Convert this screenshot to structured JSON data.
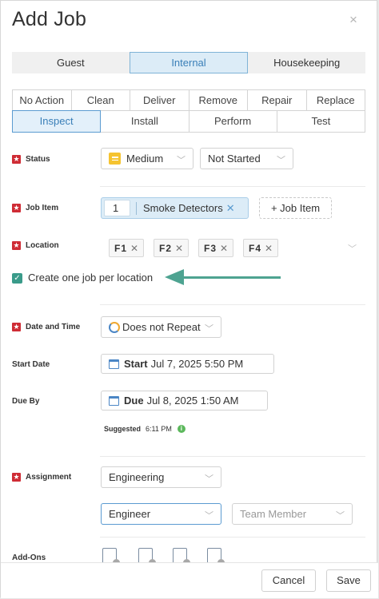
{
  "dialog": {
    "title": "Add Job",
    "close_glyph": "×"
  },
  "categories": [
    "Guest",
    "Internal",
    "Housekeeping"
  ],
  "actions_row1": [
    "No Action",
    "Clean",
    "Deliver",
    "Remove",
    "Repair",
    "Replace"
  ],
  "actions_row2": [
    "Inspect",
    "Install",
    "Perform",
    "Test"
  ],
  "status": {
    "label": "Status",
    "priority": "Medium",
    "state": "Not Started"
  },
  "job_item": {
    "label": "Job Item",
    "quantity": "1",
    "name": "Smoke Detectors",
    "add_label": "+ Job Item"
  },
  "location": {
    "label": "Location",
    "chips": [
      "F1",
      "F2",
      "F3",
      "F4"
    ],
    "per_location_label": "Create one job per location"
  },
  "date_time": {
    "label": "Date and Time",
    "repeat": "Does not Repeat"
  },
  "start_date": {
    "label": "Start Date",
    "prefix": "Start",
    "value": "Jul 7, 2025 5:50 PM"
  },
  "due_by": {
    "label": "Due By",
    "prefix": "Due",
    "value": "Jul 8, 2025 1:50 AM",
    "suggested_label": "Suggested",
    "suggested_time": "6:11 PM"
  },
  "assignment": {
    "label": "Assignment",
    "department": "Engineering",
    "role": "Engineer",
    "member_placeholder": "Team Member"
  },
  "addons": {
    "label": "Add-Ons",
    "icons": [
      "checklist-icon",
      "notes-icon",
      "image-icon",
      "attachment-icon"
    ]
  },
  "footer": {
    "cancel": "Cancel",
    "save": "Save"
  },
  "colors": {
    "accent": "#3a7fb8",
    "required": "#cf2c35",
    "arrow": "#4ea391",
    "priority_medium": "#f5c330",
    "checkbox": "#3a9b8a"
  }
}
